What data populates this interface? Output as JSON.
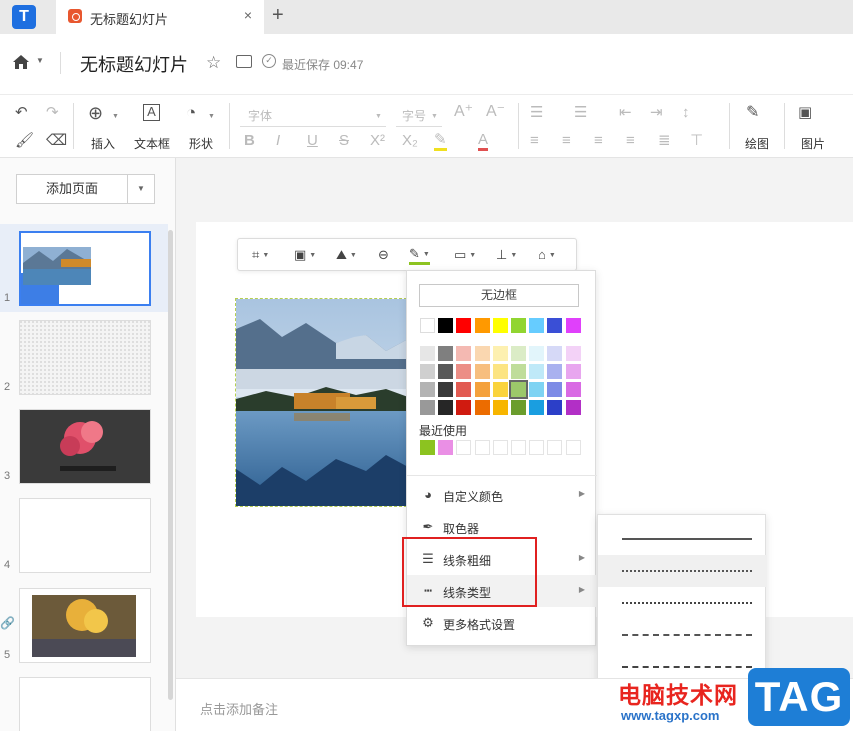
{
  "tab": {
    "title": "无标题幻灯片",
    "close": "×",
    "new_tab": "+"
  },
  "header": {
    "doc_title": "无标题幻灯片",
    "save_status": "最近保存 09:47"
  },
  "toolbar": {
    "insert_label": "插入",
    "textbox_label": "文本框",
    "shape_label": "形状",
    "font_placeholder": "字体",
    "size_placeholder": "字号",
    "draw_label": "绘图",
    "image_label": "图片"
  },
  "left_panel": {
    "add_page": "添加页面",
    "slide_numbers": [
      "1",
      "2",
      "3",
      "4",
      "5"
    ]
  },
  "notes_placeholder": "点击添加备注",
  "border_menu": {
    "no_border": "无边框",
    "recent_label": "最近使用",
    "items": [
      "自定义颜色",
      "取色器",
      "线条粗细",
      "线条类型",
      "更多格式设置"
    ],
    "theme_row": [
      "#ffffff",
      "#000000",
      "#ff0000",
      "#ff9900",
      "#ffff00",
      "#91d531",
      "#66ccff",
      "#3a4fd6",
      "#e040fb"
    ],
    "shades": [
      [
        "#e6e6e6",
        "#7f7f7f",
        "#f4b9b2",
        "#fad7b0",
        "#fdf0b0",
        "#dbecc6",
        "#e2f5fb",
        "#d6d9f7",
        "#f3d2f7"
      ],
      [
        "#cfcfcf",
        "#595959",
        "#ec8e86",
        "#f7be7e",
        "#fce482",
        "#bfdd9a",
        "#bfe9f8",
        "#a9b1ef",
        "#e8a6ef"
      ],
      [
        "#b3b3b3",
        "#3a3a3a",
        "#e25b52",
        "#f4a13c",
        "#fad33c",
        "#9cc86a",
        "#7ed3f3",
        "#7d8be6",
        "#d96ae4"
      ],
      [
        "#999999",
        "#262626",
        "#d01b10",
        "#ec6c00",
        "#f7b500",
        "#6b9d2d",
        "#1a9ee0",
        "#2c3fc8",
        "#b22fc6"
      ]
    ],
    "selected_color": "#9cc86a",
    "recent_colors": [
      "#8cc320",
      "#ea8fe5"
    ]
  },
  "line_types": [
    "solid",
    "dotted-fine",
    "dotted",
    "dashed",
    "long-dash"
  ],
  "watermark": {
    "text": "电脑技术网",
    "url": "www.tagxp.com",
    "badge": "TAG"
  }
}
